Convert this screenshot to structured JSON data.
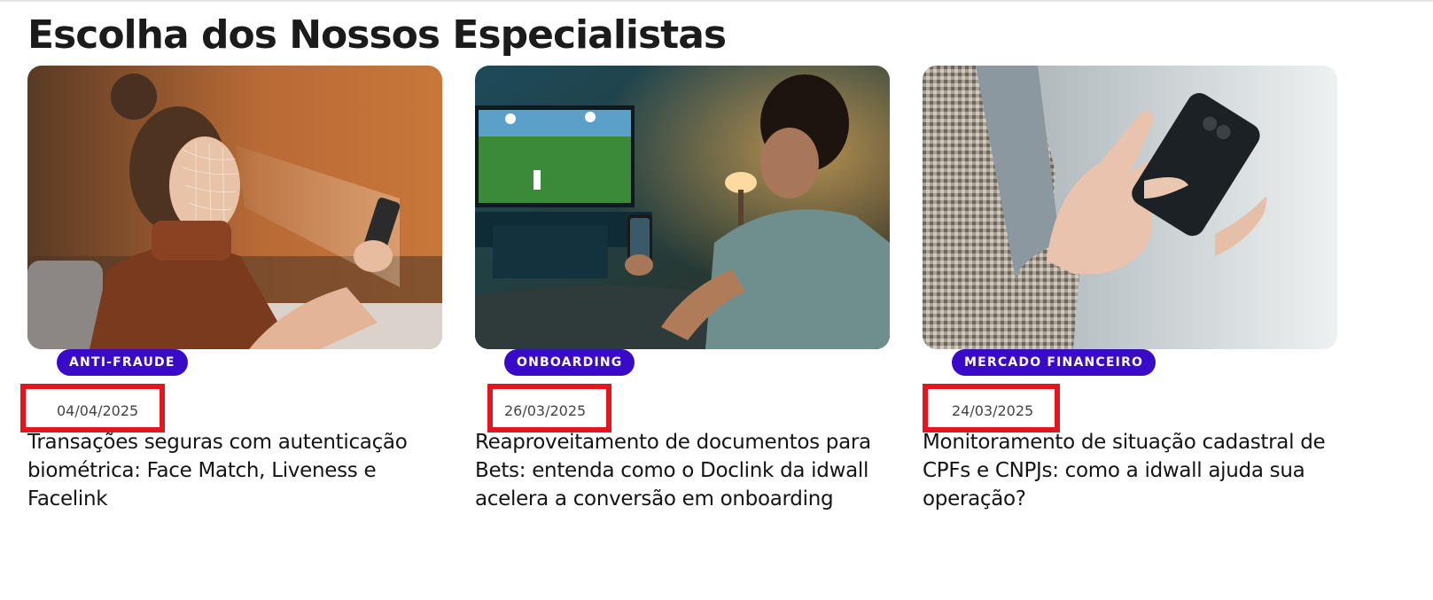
{
  "section": {
    "title": "Escolha dos Nossos Especialistas"
  },
  "cards": [
    {
      "category": "ANTI-FRAUDE",
      "date": "04/04/2025",
      "title": "Transações seguras com autenticação biométrica: Face Match, Liveness e Facelink",
      "image_subject": "woman-face-scan-phone"
    },
    {
      "category": "ONBOARDING",
      "date": "26/03/2025",
      "title": "Reaproveitamento de documentos para Bets: entenda como o Doclink da idwall acelera a conversão em onboarding",
      "image_subject": "man-watching-soccer-with-phone"
    },
    {
      "category": "MERCADO FINANCEIRO",
      "date": "24/03/2025",
      "title": "Monitoramento de situação cadastral de CPFs e CNPJs: como a idwall ajuda sua operação?",
      "image_subject": "hand-touching-smartphone"
    }
  ],
  "colors": {
    "pill_background": "#3a0ac9",
    "highlight_box": "#e3151f",
    "title_text": "#141414"
  }
}
